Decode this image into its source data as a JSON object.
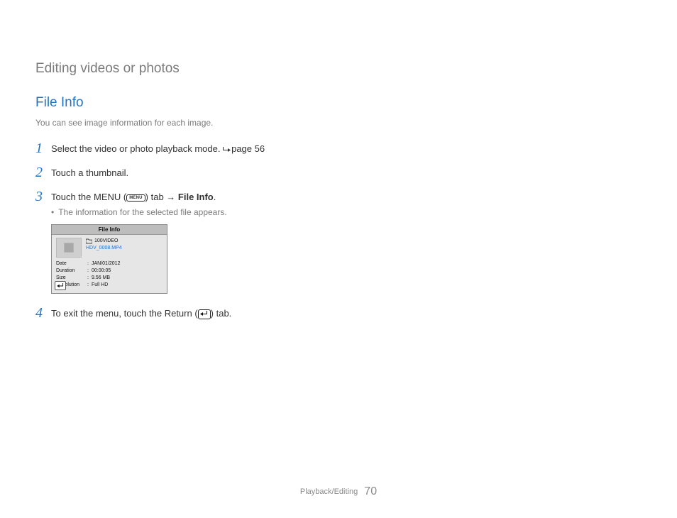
{
  "chapter_title": "Editing videos or photos",
  "section_heading": "File Info",
  "intro_text": "You can see image information for each image.",
  "steps": {
    "s1_text_a": "Select the video or photo playback mode. ",
    "s1_ref": "page 56",
    "s2_text": "Touch a thumbnail.",
    "s3_text_a": "Touch the MENU (",
    "s3_text_b": ") tab ",
    "s3_arrow": "→",
    "s3_bold": " File Info",
    "s3_text_c": ".",
    "s3_sub": "The information for the selected file appears.",
    "s4_text_a": "To exit the menu, touch the Return (",
    "s4_text_b": ") tab."
  },
  "menu_label": "MENU",
  "panel": {
    "title": "File Info",
    "folder": "100VIDEO",
    "filename": "HDV_0008.MP4",
    "rows": [
      {
        "label": "Date",
        "value": "JAN/01/2012"
      },
      {
        "label": "Duration",
        "value": "00:00:05"
      },
      {
        "label": "Size",
        "value": "9.56 MB"
      },
      {
        "label": "Resolution",
        "value": "Full HD"
      }
    ]
  },
  "footer": {
    "section": "Playback/Editing",
    "page": "70"
  }
}
